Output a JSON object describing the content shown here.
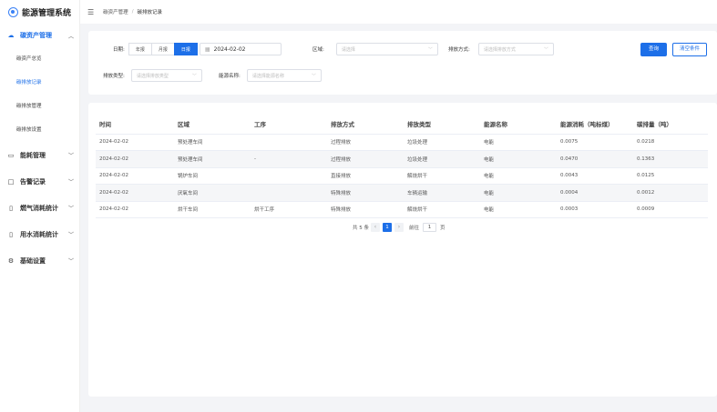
{
  "app": {
    "title": "能源管理系统"
  },
  "sidebar": {
    "groups": [
      {
        "label": "碳资产管理",
        "icon": "cloud-icon",
        "children": [
          "碳资产总览",
          "碳排放记录",
          "碳排放管理",
          "碳排放设置"
        ]
      },
      {
        "label": "能耗管理",
        "icon": "monitor-icon"
      },
      {
        "label": "告警记录",
        "icon": "alarm-icon"
      },
      {
        "label": "燃气消耗统计",
        "icon": "gas-icon"
      },
      {
        "label": "用水消耗统计",
        "icon": "water-icon"
      },
      {
        "label": "基础设置",
        "icon": "gear-icon"
      }
    ],
    "selected_child": "碳排放记录"
  },
  "breadcrumb": [
    "碳资产管理",
    "碳排放记录"
  ],
  "breadcrumb_sep": "/",
  "filters": {
    "date_label": "日期:",
    "periods": [
      "年报",
      "月报",
      "日报"
    ],
    "active_period": "日报",
    "date_value": "2024-02-02",
    "region_label": "区域:",
    "region_placeholder": "请选择",
    "emission_mode_label": "排放方式:",
    "emission_mode_placeholder": "请选择排放方式",
    "emission_type_label": "排放类型:",
    "emission_type_placeholder": "请选择排放类型",
    "energy_name_label": "能源名称:",
    "energy_name_placeholder": "请选择能源名称",
    "search_label": "查询",
    "reset_label": "清空条件"
  },
  "table": {
    "columns": [
      "时间",
      "区域",
      "工序",
      "排放方式",
      "排放类型",
      "能源名称",
      "能源消耗（吨标煤）",
      "碳排量（吨）"
    ],
    "rows": [
      [
        "2024-02-02",
        "预处理车间",
        "",
        "过程排放",
        "垃圾处理",
        "电能",
        "0.0075",
        "0.0218"
      ],
      [
        "2024-02-02",
        "预处理车间",
        "-",
        "过程排放",
        "垃圾处理",
        "电能",
        "0.0470",
        "0.1363"
      ],
      [
        "2024-02-02",
        "锅炉车间",
        "",
        "直接排放",
        "解烧烘干",
        "电能",
        "0.0043",
        "0.0125"
      ],
      [
        "2024-02-02",
        "厌氧车间",
        "",
        "特殊排放",
        "车辆运输",
        "电能",
        "0.0004",
        "0.0012"
      ],
      [
        "2024-02-02",
        "烘干车间",
        "烘干工序",
        "特殊排放",
        "解烧烘干",
        "电能",
        "0.0003",
        "0.0009"
      ]
    ]
  },
  "pagination": {
    "total_text": "共 5 条",
    "current_page": "1",
    "goto_label": "前往",
    "goto_value": "1",
    "page_suffix": "页"
  },
  "colors": {
    "accent": "#1d6fe8",
    "background": "#f3f4f7"
  }
}
